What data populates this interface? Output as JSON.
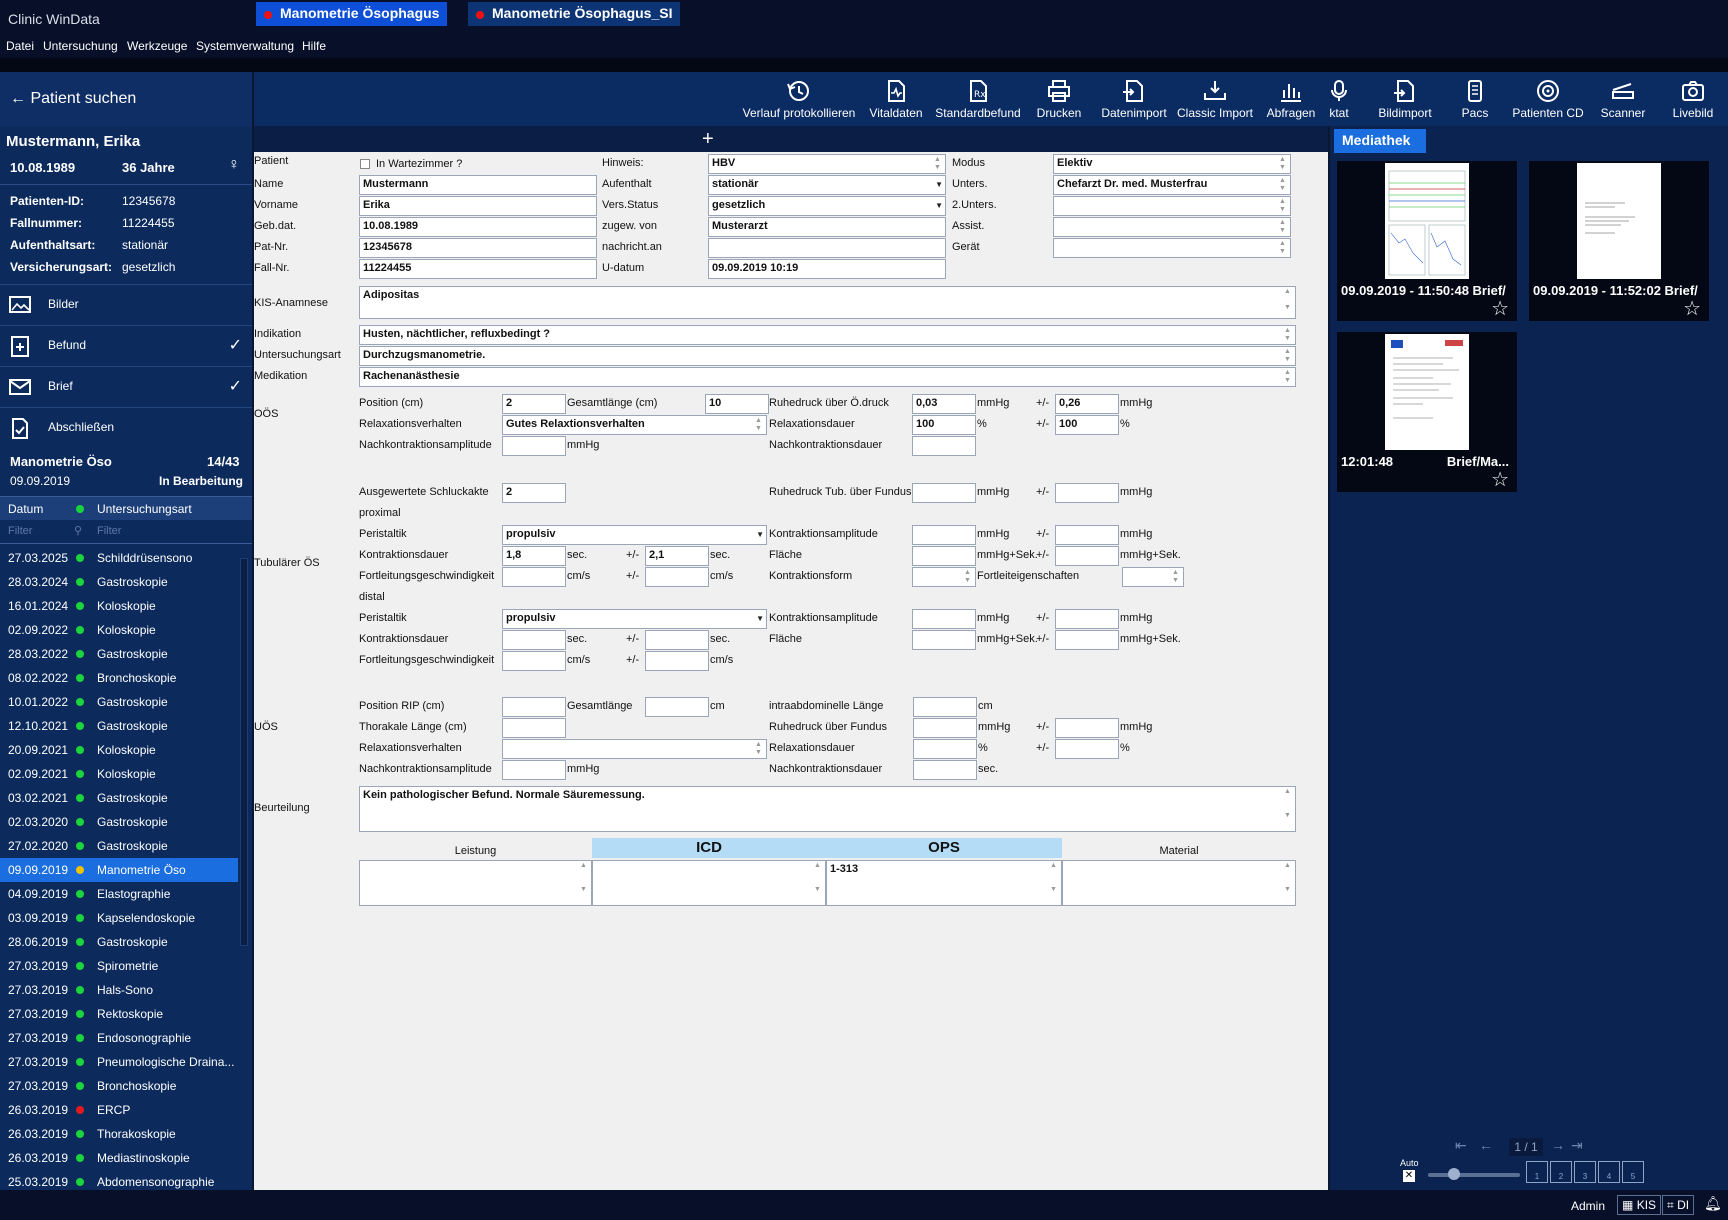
{
  "window": {
    "title": "Clinic WinData"
  },
  "menu": [
    "Datei",
    "Untersuchung",
    "Werkzeuge",
    "Systemverwaltung",
    "Hilfe"
  ],
  "search": {
    "label": "Patient suchen"
  },
  "patient": {
    "name": "Mustermann, Erika",
    "dob": "10.08.1989",
    "age": "36 Jahre",
    "fields": [
      {
        "k": "Patienten-ID:",
        "v": "12345678"
      },
      {
        "k": "Fallnummer:",
        "v": "11224455"
      },
      {
        "k": "Aufenthaltsart:",
        "v": "stationär"
      },
      {
        "k": "Versicherungsart:",
        "v": "gesetzlich"
      }
    ]
  },
  "nav": [
    {
      "label": "Bilder",
      "icon": "images-icon",
      "check": false
    },
    {
      "label": "Befund",
      "icon": "report-add-icon",
      "check": true
    },
    {
      "label": "Brief",
      "icon": "mail-icon",
      "check": true
    },
    {
      "label": "Abschließen",
      "icon": "finish-document-icon",
      "check": false
    }
  ],
  "exam": {
    "title": "Manometrie Öso",
    "count": "14/43",
    "date": "09.09.2019",
    "status": "In Bearbeitung"
  },
  "table": {
    "col_date": "Datum",
    "col_type": "Untersuchungsart",
    "filter_date": "Filter",
    "filter_type": "Filter",
    "rows": [
      {
        "d": "27.03.2025",
        "n": "Schilddrüsensono",
        "c": "#19d43a"
      },
      {
        "d": "28.03.2024",
        "n": "Gastroskopie",
        "c": "#19d43a"
      },
      {
        "d": "16.01.2024",
        "n": "Koloskopie",
        "c": "#19d43a"
      },
      {
        "d": "02.09.2022",
        "n": "Koloskopie",
        "c": "#19d43a"
      },
      {
        "d": "28.03.2022",
        "n": "Gastroskopie",
        "c": "#19d43a"
      },
      {
        "d": "08.02.2022",
        "n": "Bronchoskopie",
        "c": "#19d43a"
      },
      {
        "d": "10.01.2022",
        "n": "Gastroskopie",
        "c": "#19d43a"
      },
      {
        "d": "12.10.2021",
        "n": "Gastroskopie",
        "c": "#19d43a"
      },
      {
        "d": "20.09.2021",
        "n": "Koloskopie",
        "c": "#19d43a"
      },
      {
        "d": "02.09.2021",
        "n": "Koloskopie",
        "c": "#19d43a"
      },
      {
        "d": "03.02.2021",
        "n": "Gastroskopie",
        "c": "#19d43a"
      },
      {
        "d": "02.03.2020",
        "n": "Gastroskopie",
        "c": "#19d43a"
      },
      {
        "d": "27.02.2020",
        "n": "Gastroskopie",
        "c": "#19d43a"
      },
      {
        "d": "09.09.2019",
        "n": "Manometrie Öso",
        "c": "#f2c200",
        "sel": true
      },
      {
        "d": "04.09.2019",
        "n": "Elastographie",
        "c": "#19d43a"
      },
      {
        "d": "03.09.2019",
        "n": "Kapselendoskopie",
        "c": "#19d43a"
      },
      {
        "d": "28.06.2019",
        "n": "Gastroskopie",
        "c": "#19d43a"
      },
      {
        "d": "27.03.2019",
        "n": "Spirometrie",
        "c": "#19d43a"
      },
      {
        "d": "27.03.2019",
        "n": "Hals-Sono",
        "c": "#19d43a"
      },
      {
        "d": "27.03.2019",
        "n": "Rektoskopie",
        "c": "#19d43a"
      },
      {
        "d": "27.03.2019",
        "n": "Endosonographie",
        "c": "#19d43a"
      },
      {
        "d": "27.03.2019",
        "n": "Pneumologische Draina...",
        "c": "#19d43a"
      },
      {
        "d": "27.03.2019",
        "n": "Bronchoskopie",
        "c": "#19d43a"
      },
      {
        "d": "26.03.2019",
        "n": "ERCP",
        "c": "#e11b1b"
      },
      {
        "d": "26.03.2019",
        "n": "Thorakoskopie",
        "c": "#19d43a"
      },
      {
        "d": "26.03.2019",
        "n": "Mediastinoskopie",
        "c": "#19d43a"
      },
      {
        "d": "25.03.2019",
        "n": "Abdomensonographie",
        "c": "#19d43a"
      }
    ]
  },
  "toolbar": [
    {
      "label": "Verlauf protokollieren",
      "icon": "history-icon"
    },
    {
      "label": "Vitaldaten",
      "icon": "vitals-icon"
    },
    {
      "label": "Standardbefund",
      "icon": "prescription-icon"
    },
    {
      "label": "Drucken",
      "icon": "printer-icon"
    },
    {
      "label": "Datenimport",
      "icon": "data-import-icon"
    },
    {
      "label": "Classic Import",
      "icon": "classic-import-icon"
    },
    {
      "label": "Abfragen",
      "icon": "bar-chart-icon"
    },
    {
      "label": "ktat",
      "icon": "microphone-icon"
    },
    {
      "label": "Bildimport",
      "icon": "image-import-icon"
    },
    {
      "label": "Pacs",
      "icon": "pacs-icon"
    },
    {
      "label": "Patienten CD",
      "icon": "cd-icon"
    },
    {
      "label": "Scanner",
      "icon": "scanner-icon"
    },
    {
      "label": "Livebild",
      "icon": "camera-icon"
    }
  ],
  "tabs": [
    {
      "label": "Manometrie Ösophagus"
    },
    {
      "label": "Manometrie Ösophagus_SI"
    }
  ],
  "tab_add": "+",
  "form": {
    "sections": {
      "patient": "Patient",
      "kis": "KIS-Anamnese",
      "indikation": "Indikation",
      "unt_art": "Untersuchungsart",
      "medikation": "Medikation",
      "oos": "OÖS",
      "tub": "Tubulärer ÖS",
      "uos": "UÖS",
      "beurteilung": "Beurteilung"
    },
    "in_wartezimmer": "In Wartezimmer ?",
    "labels": {
      "name": "Name",
      "vorname": "Vorname",
      "gebdat": "Geb.dat.",
      "patnr": "Pat-Nr.",
      "fallnr": "Fall-Nr.",
      "hinweis": "Hinweis:",
      "aufenthalt": "Aufenthalt",
      "versstatus": "Vers.Status",
      "zugew": "zugew. von",
      "nachricht": "nachricht.an",
      "udatum": "U-datum",
      "modus": "Modus",
      "unters": "Unters.",
      "unters2": "2.Unters.",
      "assist": "Assist.",
      "geraet": "Gerät"
    },
    "values": {
      "name": "Mustermann",
      "vorname": "Erika",
      "gebdat": "10.08.1989",
      "patnr": "12345678",
      "fallnr": "11224455",
      "hinweis": "HBV",
      "aufenthalt": "stationär",
      "versstatus": "gesetzlich",
      "zugew": "Musterarzt",
      "nachricht": "",
      "udatum": "09.09.2019 10:19",
      "modus": "Elektiv",
      "unters": "Chefarzt Dr. med. Musterfrau",
      "unters2": "",
      "assist": "",
      "geraet": "",
      "kis": "Adipositas",
      "indikation": "Husten, nächtlicher, refluxbedingt ?",
      "unt_art": "Durchzugsmanometrie.",
      "medikation": "Rachenanästhesie",
      "beurteilung": "Kein pathologischer Befund. Normale Säuremessung."
    },
    "oos": {
      "position_lbl": "Position (cm)",
      "position": "2",
      "gesamt_lbl": "Gesamtlänge (cm)",
      "gesamt": "10",
      "ruhe_lbl": "Ruhedruck über Ö.druck",
      "ruhe": "0,03",
      "ruhe_unit": "mmHg",
      "pm": "+/-",
      "ruhe_pm": "0,26",
      "ruhe_pm_unit": "mmHg",
      "relax_lbl": "Relaxationsverhalten",
      "relax": "Gutes Relaxtionsverhalten",
      "relaxdauer_lbl": "Relaxationsdauer",
      "relaxdauer": "100",
      "pct": "%",
      "relaxdauer_pm": "100",
      "pct2": "%",
      "nka_lbl": "Nachkontraktionsamplitude",
      "nka_unit": "mmHg",
      "nkd_lbl": "Nachkontraktionsdauer"
    },
    "tub": {
      "schluck_lbl": "Ausgewertete Schluckakte",
      "schluck": "2",
      "ruhe_fundus_lbl": "Ruhedruck Tub. über Fundus",
      "mmhg": "mmHg",
      "pm": "+/-",
      "proximal": "proximal",
      "distal": "distal",
      "peristaltik_lbl": "Peristaltik",
      "peristaltik": "propulsiv",
      "ka_lbl": "Kontraktionsamplitude",
      "kd_lbl": "Kontraktionsdauer",
      "kd": "1,8",
      "sec": "sec.",
      "kd_pm": "2,1",
      "flaeche_lbl": "Fläche",
      "mmhgsek": "mmHg+Sek.",
      "fg_lbl": "Fortleitungsgeschwindigkeit",
      "cms": "cm/s",
      "kform_lbl": "Kontraktionsform",
      "feig_lbl": "Fortleiteigenschaften",
      "peristaltik2": "propulsiv"
    },
    "uos": {
      "pos_lbl": "Position RIP (cm)",
      "gesamt_lbl": "Gesamtlänge",
      "cm": "cm",
      "intra_lbl": "intraabdominelle Länge",
      "thor_lbl": "Thorakale Länge (cm)",
      "ruhe_lbl": "Ruhedruck über Fundus",
      "mmhg": "mmHg",
      "pm": "+/-",
      "relax_lbl": "Relaxationsverhalten",
      "relaxdauer_lbl": "Relaxationsdauer",
      "pct": "%",
      "nka_lbl": "Nachkontraktionsamplitude",
      "nkd_lbl": "Nachkontraktionsdauer",
      "sec": "sec."
    },
    "bottom": {
      "leistung": "Leistung",
      "icd": "ICD",
      "ops": "OPS",
      "material": "Material",
      "ops_value": "1-313"
    }
  },
  "mediathek": {
    "tab": "Mediathek",
    "items": [
      {
        "caption": "09.09.2019 - 11:50:48  Brief/"
      },
      {
        "caption": "09.09.2019 - 11:52:02  Brief/"
      },
      {
        "caption_left": "12:01:48",
        "caption_right": "Brief/Ma..."
      }
    ],
    "page": "1 / 1",
    "auto": "Auto",
    "layout_buttons": [
      "1",
      "2",
      "3",
      "4",
      "5"
    ]
  },
  "status": {
    "user": "Admin",
    "kis": "KIS",
    "di": "DI"
  },
  "colors": {
    "accent": "#1a6ee0",
    "panel": "#0c2a5c",
    "toolbar": "#0b2b63",
    "status_ok": "#19d43a",
    "status_open": "#f2c200",
    "status_error": "#e11b1b"
  }
}
